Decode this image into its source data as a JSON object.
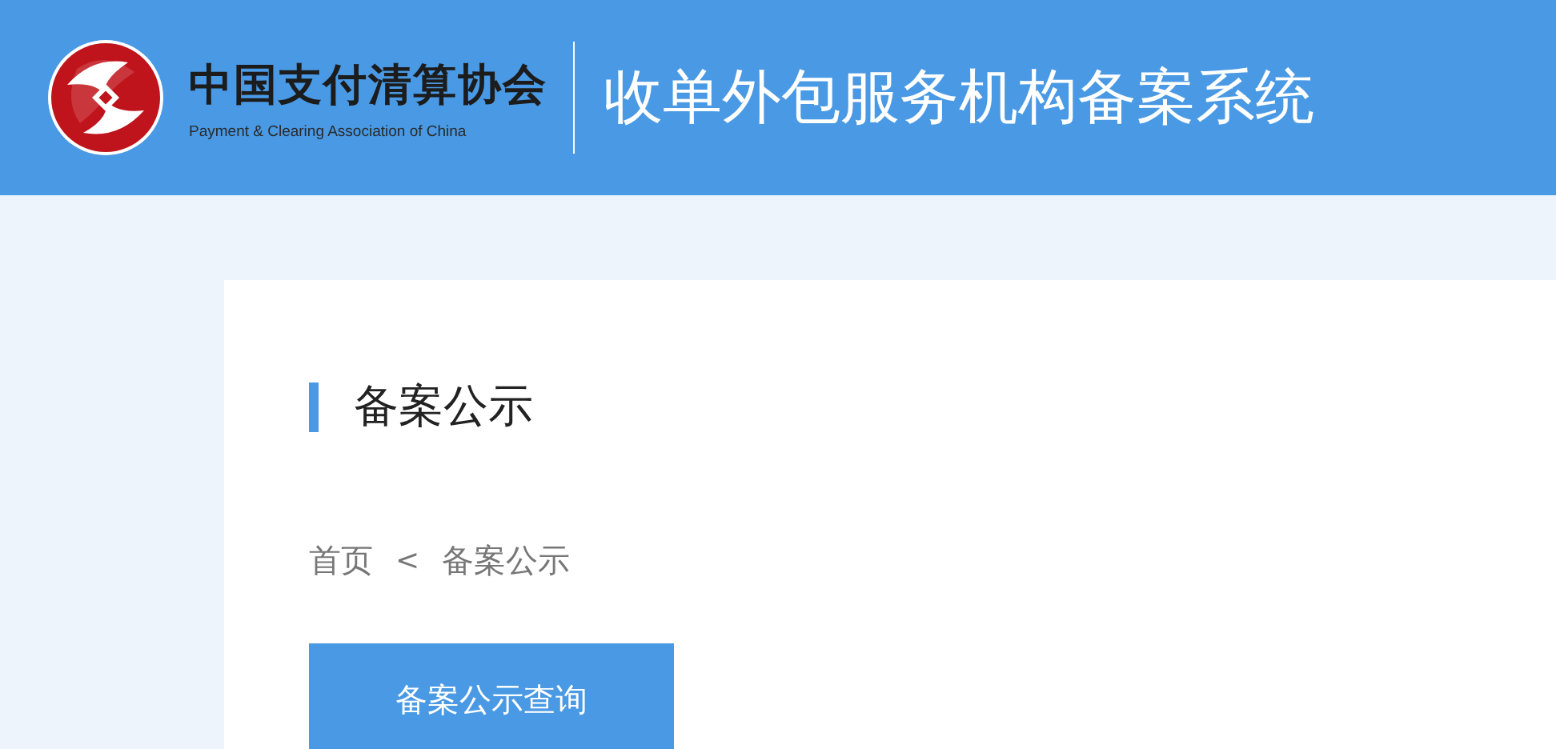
{
  "header": {
    "org_name": "中国支付清算协会",
    "org_name_en": "Payment & Clearing Association of China",
    "system_title": "收单外包服务机构备案系统"
  },
  "section_title": "备案公示",
  "breadcrumb": [
    {
      "label": "首页"
    },
    {
      "label": "备案公示"
    }
  ],
  "breadcrumb_separator": "<",
  "tabs": [
    {
      "label": "备案公示查询",
      "selected": true
    }
  ]
}
